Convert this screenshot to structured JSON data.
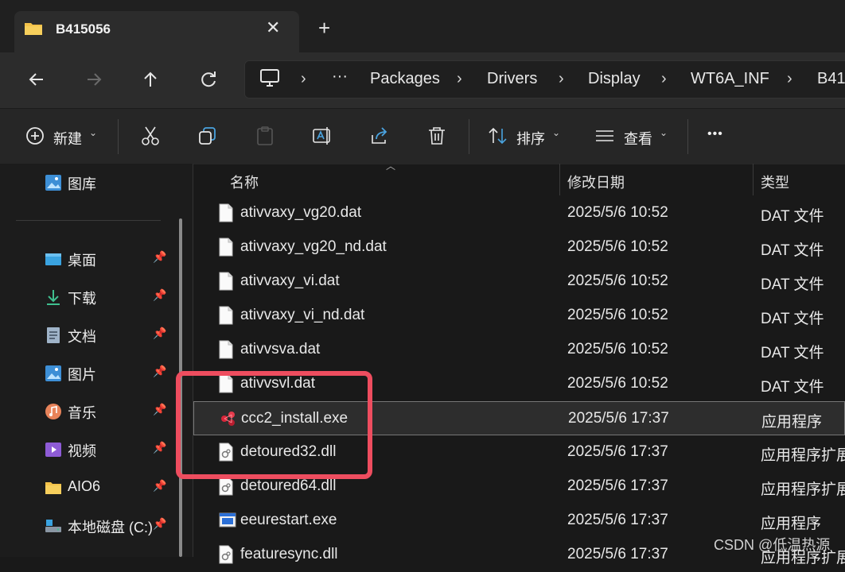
{
  "tab": {
    "title": "B415056",
    "close_glyph": "✕",
    "new_glyph": "+"
  },
  "nav": {
    "more_glyph": "···",
    "breadcrumbs": [
      "Packages",
      "Drivers",
      "Display",
      "WT6A_INF",
      "B41"
    ]
  },
  "toolbar": {
    "new_label": "新建",
    "sort_label": "排序",
    "view_label": "查看",
    "more_glyph": "•••"
  },
  "sidebar": {
    "gallery": "图库",
    "items": [
      {
        "label": "桌面",
        "icon": "desktop-icon"
      },
      {
        "label": "下载",
        "icon": "download-icon"
      },
      {
        "label": "文档",
        "icon": "document-icon"
      },
      {
        "label": "图片",
        "icon": "pictures-icon"
      },
      {
        "label": "音乐",
        "icon": "music-icon"
      },
      {
        "label": "视频",
        "icon": "video-icon"
      },
      {
        "label": "AIO6",
        "icon": "folder-icon"
      },
      {
        "label": "本地磁盘 (C:)",
        "icon": "drive-icon"
      }
    ]
  },
  "columns": {
    "name": "名称",
    "date": "修改日期",
    "type": "类型"
  },
  "files": [
    {
      "name": "ativvaxy_vg20.dat",
      "date": "2025/5/6 10:52",
      "type": "DAT 文件",
      "icon": "file-icon"
    },
    {
      "name": "ativvaxy_vg20_nd.dat",
      "date": "2025/5/6 10:52",
      "type": "DAT 文件",
      "icon": "file-icon"
    },
    {
      "name": "ativvaxy_vi.dat",
      "date": "2025/5/6 10:52",
      "type": "DAT 文件",
      "icon": "file-icon"
    },
    {
      "name": "ativvaxy_vi_nd.dat",
      "date": "2025/5/6 10:52",
      "type": "DAT 文件",
      "icon": "file-icon"
    },
    {
      "name": "ativvsva.dat",
      "date": "2025/5/6 10:52",
      "type": "DAT 文件",
      "icon": "file-icon"
    },
    {
      "name": "ativvsvl.dat",
      "date": "2025/5/6 10:52",
      "type": "DAT 文件",
      "icon": "file-icon"
    },
    {
      "name": "ccc2_install.exe",
      "date": "2025/5/6 17:37",
      "type": "应用程序",
      "icon": "installer-icon",
      "selected": true
    },
    {
      "name": "detoured32.dll",
      "date": "2025/5/6 17:37",
      "type": "应用程序扩展",
      "icon": "dll-icon"
    },
    {
      "name": "detoured64.dll",
      "date": "2025/5/6 17:37",
      "type": "应用程序扩展",
      "icon": "dll-icon"
    },
    {
      "name": "eeurestart.exe",
      "date": "2025/5/6 17:37",
      "type": "应用程序",
      "icon": "exe-icon"
    },
    {
      "name": "featuresync.dll",
      "date": "2025/5/6 17:37",
      "type": "应用程序扩展",
      "icon": "dll-icon"
    }
  ],
  "watermark": "CSDN @低温热源",
  "colors": {
    "highlight": "#ee4d5f",
    "folder": "#f3c24a",
    "accent": "#4aa3df"
  }
}
